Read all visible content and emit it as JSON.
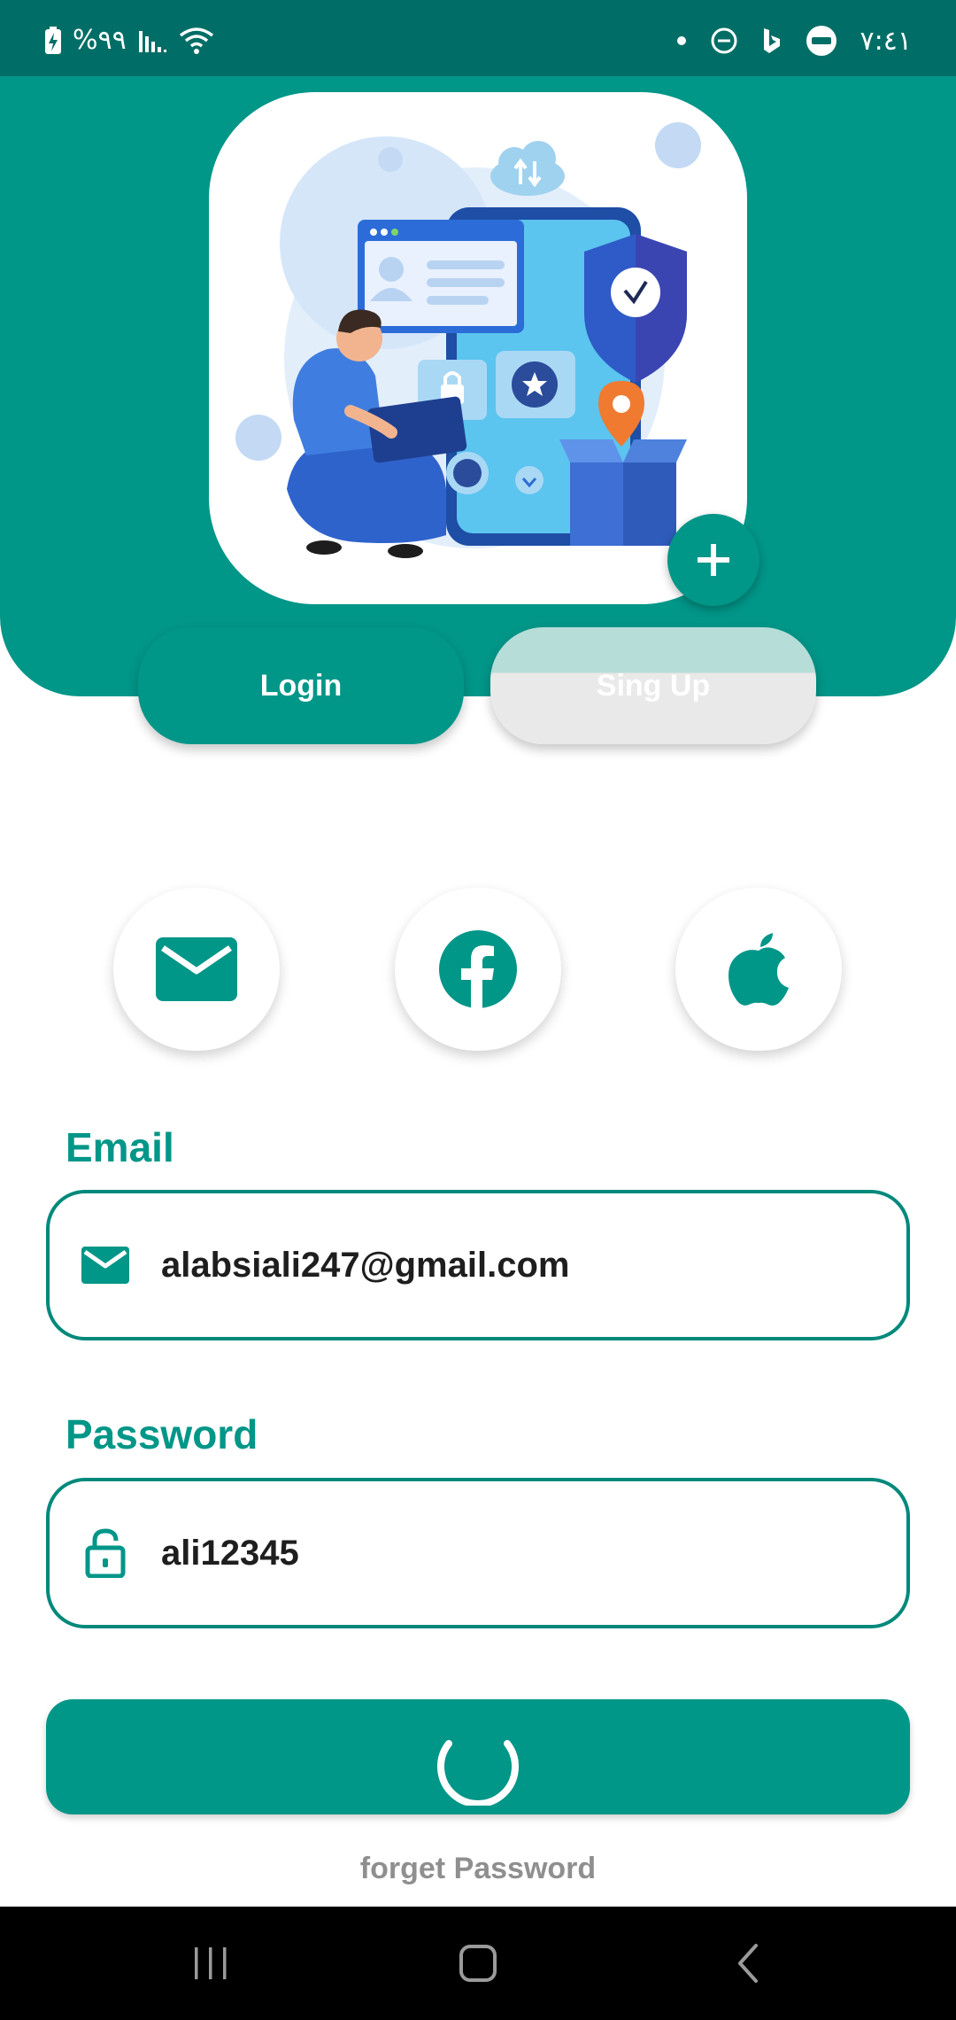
{
  "status_bar": {
    "battery": "%٩٩",
    "time": "٧:٤١",
    "icons": [
      "battery-charging-icon",
      "signal-icon",
      "wifi-icon",
      "dot-icon",
      "do-not-disturb-icon",
      "bing-icon",
      "365-icon"
    ]
  },
  "header": {
    "illustration": "mobile-security-illustration",
    "add_button_icon": "plus-icon"
  },
  "tabs": {
    "login_label": "Login",
    "signup_label": "Sing Up"
  },
  "social_buttons": [
    {
      "icon": "mail-icon"
    },
    {
      "icon": "facebook-icon"
    },
    {
      "icon": "apple-icon"
    }
  ],
  "form": {
    "email_label": "Email",
    "email_value": "alabsiali247@gmail.com",
    "password_label": "Password",
    "password_value": "ali12345"
  },
  "submit": {
    "state": "loading",
    "icon": "loading-spinner-icon"
  },
  "forgot_password": "forget Password",
  "nav": {
    "icons": [
      "recent-apps-icon",
      "home-icon",
      "back-icon"
    ]
  },
  "colors": {
    "primary": "#009688",
    "status_bar": "#006e66",
    "field_border": "#00897b",
    "muted_text": "#8f8f8f"
  }
}
